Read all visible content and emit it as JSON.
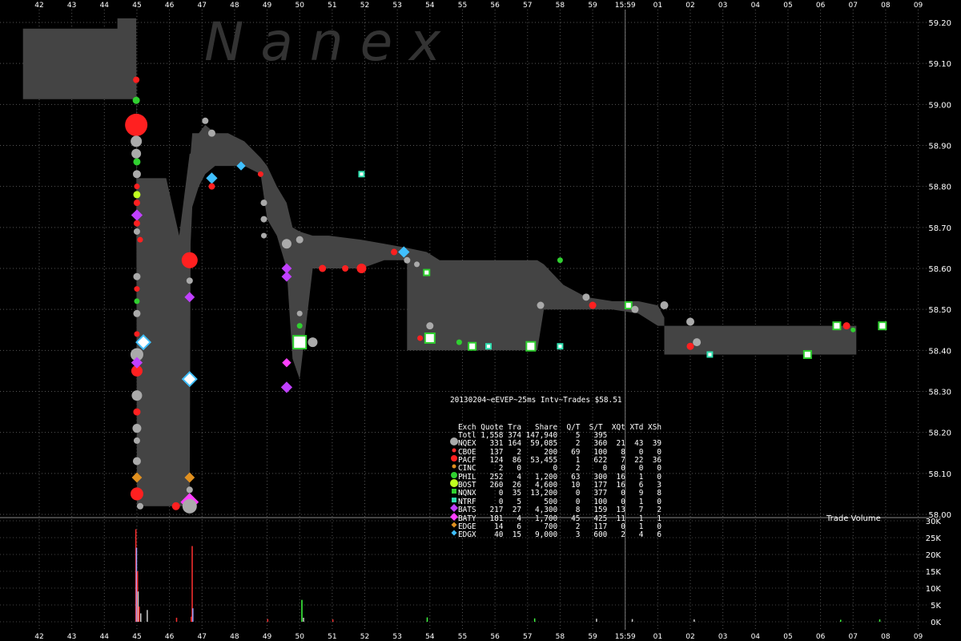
{
  "chart_data": {
    "type": "scatter",
    "watermark": "Nanex",
    "title": "20130204~eEVEP~25ms Intv~Trades $58.51",
    "x_ticks_top": [
      "42",
      "43",
      "44",
      "45",
      "46",
      "47",
      "48",
      "49",
      "50",
      "51",
      "52",
      "53",
      "54",
      "55",
      "56",
      "57",
      "58",
      "59",
      "15:59",
      "01",
      "02",
      "03",
      "04",
      "05",
      "06",
      "07",
      "08",
      "09"
    ],
    "x_ticks_bottom": [
      "42",
      "43",
      "44",
      "45",
      "46",
      "47",
      "48",
      "49",
      "50",
      "51",
      "52",
      "53",
      "54",
      "55",
      "56",
      "57",
      "58",
      "59",
      "15:59",
      "01",
      "02",
      "03",
      "04",
      "05",
      "06",
      "07",
      "08",
      "09"
    ],
    "price_axis": {
      "ticks": [
        "59.20",
        "59.10",
        "59.00",
        "58.90",
        "58.80",
        "58.70",
        "58.60",
        "58.50",
        "58.40",
        "58.30",
        "58.20",
        "58.10",
        "58.00"
      ],
      "ylim": [
        58.0,
        59.2
      ]
    },
    "volume_axis": {
      "label": "Trade Volume",
      "ticks": [
        "30K",
        "25K",
        "20K",
        "15K",
        "10K",
        "5K",
        "0K"
      ],
      "ylim": [
        0,
        30000
      ]
    },
    "nbbo_spread": [
      [
        41.5,
        59.013,
        59.185
      ],
      [
        44.4,
        59.013,
        59.185
      ],
      [
        44.4,
        59.013,
        59.21
      ],
      [
        44.98,
        59.013,
        59.21
      ],
      [
        45.0,
        58.02,
        58.82
      ],
      [
        45.05,
        58.02,
        58.82
      ],
      [
        45.06,
        58.02,
        58.82
      ],
      [
        45.9,
        58.02,
        58.82
      ],
      [
        46.3,
        58.02,
        58.68
      ],
      [
        46.62,
        58.02,
        58.88
      ],
      [
        46.65,
        58.66,
        58.88
      ],
      [
        46.7,
        58.75,
        58.93
      ],
      [
        46.9,
        58.8,
        58.93
      ],
      [
        47.1,
        58.83,
        58.95
      ],
      [
        47.4,
        58.85,
        58.93
      ],
      [
        47.8,
        58.85,
        58.93
      ],
      [
        48.3,
        58.85,
        58.91
      ],
      [
        48.8,
        58.83,
        58.87
      ],
      [
        49.0,
        58.72,
        58.85
      ],
      [
        49.3,
        58.68,
        58.8
      ],
      [
        49.6,
        58.6,
        58.76
      ],
      [
        49.78,
        58.38,
        58.7
      ],
      [
        50.0,
        58.33,
        58.69
      ],
      [
        50.4,
        58.6,
        58.68
      ],
      [
        50.9,
        58.6,
        58.68
      ],
      [
        51.9,
        58.6,
        58.67
      ],
      [
        52.6,
        58.62,
        58.66
      ],
      [
        53.3,
        58.62,
        58.65
      ],
      [
        53.3,
        58.4,
        58.65
      ],
      [
        53.9,
        58.4,
        58.64
      ],
      [
        54.3,
        58.4,
        58.62
      ],
      [
        54.5,
        58.4,
        58.62
      ],
      [
        57.3,
        58.4,
        58.62
      ],
      [
        57.5,
        58.5,
        58.61
      ],
      [
        58.1,
        58.5,
        58.56
      ],
      [
        58.8,
        58.5,
        58.53
      ],
      [
        59.6,
        58.5,
        58.52
      ],
      [
        60.4,
        58.49,
        58.52
      ],
      [
        61.0,
        58.46,
        58.51
      ],
      [
        61.2,
        58.46,
        58.48
      ],
      [
        61.2,
        58.39,
        58.46
      ],
      [
        67.1,
        58.39,
        58.46
      ],
      [
        67.1,
        58.4,
        58.48
      ]
    ],
    "trades": [
      {
        "x": 44.98,
        "y": 59.06,
        "ex": "PACF",
        "s": 8
      },
      {
        "x": 44.98,
        "y": 59.01,
        "ex": "PHIL",
        "s": 9
      },
      {
        "x": 44.98,
        "y": 58.95,
        "ex": "PACF",
        "s": 28
      },
      {
        "x": 44.98,
        "y": 58.91,
        "ex": "NQEX",
        "s": 14
      },
      {
        "x": 44.98,
        "y": 58.88,
        "ex": "NQEX",
        "s": 12
      },
      {
        "x": 45.0,
        "y": 58.86,
        "ex": "PHIL",
        "s": 9
      },
      {
        "x": 45.0,
        "y": 58.83,
        "ex": "NQEX",
        "s": 10
      },
      {
        "x": 45.0,
        "y": 58.8,
        "ex": "PACF",
        "s": 7
      },
      {
        "x": 45.0,
        "y": 58.78,
        "ex": "BOST",
        "s": 9
      },
      {
        "x": 45.0,
        "y": 58.76,
        "ex": "PACF",
        "s": 8
      },
      {
        "x": 45.0,
        "y": 58.73,
        "ex": "BATS",
        "s": 8
      },
      {
        "x": 45.0,
        "y": 58.71,
        "ex": "PACF",
        "s": 8
      },
      {
        "x": 45.0,
        "y": 58.69,
        "ex": "NQEX",
        "s": 8
      },
      {
        "x": 45.1,
        "y": 58.67,
        "ex": "PACF",
        "s": 7
      },
      {
        "x": 45.0,
        "y": 58.58,
        "ex": "NQEX",
        "s": 9
      },
      {
        "x": 45.0,
        "y": 58.55,
        "ex": "PACF",
        "s": 7
      },
      {
        "x": 45.0,
        "y": 58.52,
        "ex": "PHIL",
        "s": 7
      },
      {
        "x": 45.0,
        "y": 58.49,
        "ex": "NQEX",
        "s": 9
      },
      {
        "x": 45.0,
        "y": 58.44,
        "ex": "PACF",
        "s": 7
      },
      {
        "x": 45.0,
        "y": 58.39,
        "ex": "NQEX",
        "s": 16
      },
      {
        "x": 45.0,
        "y": 58.35,
        "ex": "PACF",
        "s": 14
      },
      {
        "x": 45.0,
        "y": 58.37,
        "ex": "BATS",
        "s": 8
      },
      {
        "x": 45.0,
        "y": 58.29,
        "ex": "NQEX",
        "s": 13
      },
      {
        "x": 45.0,
        "y": 58.25,
        "ex": "PACF",
        "s": 9
      },
      {
        "x": 45.0,
        "y": 58.21,
        "ex": "NQEX",
        "s": 11
      },
      {
        "x": 45.0,
        "y": 58.18,
        "ex": "NQEX",
        "s": 8
      },
      {
        "x": 45.0,
        "y": 58.13,
        "ex": "NQEX",
        "s": 10
      },
      {
        "x": 45.0,
        "y": 58.09,
        "ex": "EDGE",
        "s": 7
      },
      {
        "x": 45.0,
        "y": 58.05,
        "ex": "PACF",
        "s": 16
      },
      {
        "x": 45.1,
        "y": 58.02,
        "ex": "NQEX",
        "s": 8
      },
      {
        "x": 45.2,
        "y": 58.42,
        "ex": "EDGX",
        "s": 12
      },
      {
        "x": 46.2,
        "y": 58.02,
        "ex": "PACF",
        "s": 10
      },
      {
        "x": 46.62,
        "y": 58.62,
        "ex": "PACF",
        "s": 20
      },
      {
        "x": 46.62,
        "y": 58.57,
        "ex": "NQEX",
        "s": 8
      },
      {
        "x": 46.62,
        "y": 58.53,
        "ex": "BATS",
        "s": 7
      },
      {
        "x": 46.62,
        "y": 58.33,
        "ex": "EDGX",
        "s": 12
      },
      {
        "x": 46.62,
        "y": 58.09,
        "ex": "EDGE",
        "s": 7
      },
      {
        "x": 46.62,
        "y": 58.06,
        "ex": "NQEX",
        "s": 8
      },
      {
        "x": 46.62,
        "y": 58.03,
        "ex": "BATY",
        "s": 14
      },
      {
        "x": 46.62,
        "y": 58.02,
        "ex": "NQEX",
        "s": 18
      },
      {
        "x": 47.1,
        "y": 58.96,
        "ex": "NQEX",
        "s": 8
      },
      {
        "x": 47.3,
        "y": 58.93,
        "ex": "NQEX",
        "s": 9
      },
      {
        "x": 47.3,
        "y": 58.82,
        "ex": "EDGX",
        "s": 8
      },
      {
        "x": 47.3,
        "y": 58.8,
        "ex": "PACF",
        "s": 8
      },
      {
        "x": 48.2,
        "y": 58.85,
        "ex": "EDGX",
        "s": 6
      },
      {
        "x": 48.8,
        "y": 58.83,
        "ex": "PACF",
        "s": 7
      },
      {
        "x": 48.9,
        "y": 58.76,
        "ex": "NQEX",
        "s": 8
      },
      {
        "x": 48.9,
        "y": 58.72,
        "ex": "NQEX",
        "s": 8
      },
      {
        "x": 48.9,
        "y": 58.68,
        "ex": "NQEX",
        "s": 7
      },
      {
        "x": 49.6,
        "y": 58.66,
        "ex": "NQEX",
        "s": 12
      },
      {
        "x": 50.0,
        "y": 58.67,
        "ex": "NQEX",
        "s": 9
      },
      {
        "x": 49.6,
        "y": 58.6,
        "ex": "BATS",
        "s": 7
      },
      {
        "x": 49.6,
        "y": 58.58,
        "ex": "BATS",
        "s": 7
      },
      {
        "x": 49.6,
        "y": 58.37,
        "ex": "BATY",
        "s": 6
      },
      {
        "x": 49.6,
        "y": 58.31,
        "ex": "BATS",
        "s": 8
      },
      {
        "x": 50.0,
        "y": 58.49,
        "ex": "NQEX",
        "s": 7
      },
      {
        "x": 50.0,
        "y": 58.46,
        "ex": "PHIL",
        "s": 7
      },
      {
        "x": 50.0,
        "y": 58.42,
        "ex": "NQVX",
        "s": 16
      },
      {
        "x": 50.4,
        "y": 58.42,
        "ex": "NQEX",
        "s": 12
      },
      {
        "x": 50.7,
        "y": 58.6,
        "ex": "PACF",
        "s": 9
      },
      {
        "x": 51.4,
        "y": 58.6,
        "ex": "PACF",
        "s": 8
      },
      {
        "x": 51.9,
        "y": 58.6,
        "ex": "PACF",
        "s": 12
      },
      {
        "x": 51.9,
        "y": 58.83,
        "ex": "NTRF",
        "s": 6
      },
      {
        "x": 52.9,
        "y": 58.64,
        "ex": "PACF",
        "s": 8
      },
      {
        "x": 53.2,
        "y": 58.64,
        "ex": "EDGX",
        "s": 8
      },
      {
        "x": 53.3,
        "y": 58.62,
        "ex": "NQEX",
        "s": 8
      },
      {
        "x": 53.6,
        "y": 58.61,
        "ex": "NQEX",
        "s": 7
      },
      {
        "x": 53.9,
        "y": 58.59,
        "ex": "NQVX",
        "s": 7
      },
      {
        "x": 53.7,
        "y": 58.43,
        "ex": "PACF",
        "s": 7
      },
      {
        "x": 54.0,
        "y": 58.46,
        "ex": "NQEX",
        "s": 9
      },
      {
        "x": 54.0,
        "y": 58.43,
        "ex": "NQVX",
        "s": 12
      },
      {
        "x": 54.9,
        "y": 58.42,
        "ex": "PHIL",
        "s": 7
      },
      {
        "x": 55.3,
        "y": 58.41,
        "ex": "NQVX",
        "s": 9
      },
      {
        "x": 55.8,
        "y": 58.41,
        "ex": "NTRF",
        "s": 6
      },
      {
        "x": 57.1,
        "y": 58.41,
        "ex": "NQVX",
        "s": 11
      },
      {
        "x": 58.0,
        "y": 58.41,
        "ex": "NTRF",
        "s": 6
      },
      {
        "x": 58.0,
        "y": 58.62,
        "ex": "PHIL",
        "s": 7
      },
      {
        "x": 57.4,
        "y": 58.51,
        "ex": "NQEX",
        "s": 9
      },
      {
        "x": 58.8,
        "y": 58.53,
        "ex": "NQEX",
        "s": 9
      },
      {
        "x": 59.0,
        "y": 58.51,
        "ex": "PACF",
        "s": 9
      },
      {
        "x": 60.1,
        "y": 58.51,
        "ex": "NQVX",
        "s": 8
      },
      {
        "x": 60.3,
        "y": 58.5,
        "ex": "NQEX",
        "s": 9
      },
      {
        "x": 61.2,
        "y": 58.51,
        "ex": "NQEX",
        "s": 10
      },
      {
        "x": 62.0,
        "y": 58.47,
        "ex": "NQEX",
        "s": 10
      },
      {
        "x": 62.0,
        "y": 58.41,
        "ex": "PACF",
        "s": 9
      },
      {
        "x": 62.2,
        "y": 58.42,
        "ex": "NQEX",
        "s": 10
      },
      {
        "x": 62.6,
        "y": 58.39,
        "ex": "NTRF",
        "s": 6
      },
      {
        "x": 65.6,
        "y": 58.39,
        "ex": "NQVX",
        "s": 9
      },
      {
        "x": 66.5,
        "y": 58.46,
        "ex": "NQVX",
        "s": 9
      },
      {
        "x": 66.8,
        "y": 58.46,
        "ex": "PACF",
        "s": 9
      },
      {
        "x": 67.0,
        "y": 58.45,
        "ex": "PHIL",
        "s": 6
      },
      {
        "x": 67.9,
        "y": 58.46,
        "ex": "NQVX",
        "s": 9
      }
    ],
    "volume_bars": [
      {
        "x": 44.95,
        "v": 27500,
        "c": "#ff3030"
      },
      {
        "x": 44.97,
        "v": 22000,
        "c": "#9aa0ff"
      },
      {
        "x": 45.0,
        "v": 15000,
        "c": "#ff3030"
      },
      {
        "x": 45.02,
        "v": 9000,
        "c": "#cccccc"
      },
      {
        "x": 45.05,
        "v": 4500,
        "c": "#ff3030"
      },
      {
        "x": 45.1,
        "v": 2500,
        "c": "#cccccc"
      },
      {
        "x": 45.3,
        "v": 3500,
        "c": "#cccccc"
      },
      {
        "x": 46.2,
        "v": 1200,
        "c": "#ff3030"
      },
      {
        "x": 46.65,
        "v": 1500,
        "c": "#ff3030"
      },
      {
        "x": 46.68,
        "v": 22500,
        "c": "#ff3030"
      },
      {
        "x": 46.7,
        "v": 4000,
        "c": "#9aa0ff"
      },
      {
        "x": 50.05,
        "v": 6500,
        "c": "#40ff40"
      },
      {
        "x": 50.1,
        "v": 1200,
        "c": "#cccccc"
      },
      {
        "x": 49.0,
        "v": 800,
        "c": "#ff3030"
      },
      {
        "x": 51.0,
        "v": 700,
        "c": "#ff3030"
      },
      {
        "x": 53.9,
        "v": 1300,
        "c": "#40ff40"
      },
      {
        "x": 57.2,
        "v": 1000,
        "c": "#40ff40"
      },
      {
        "x": 59.1,
        "v": 900,
        "c": "#cccccc"
      },
      {
        "x": 60.2,
        "v": 800,
        "c": "#cccccc"
      },
      {
        "x": 62.1,
        "v": 700,
        "c": "#cccccc"
      },
      {
        "x": 66.6,
        "v": 600,
        "c": "#40ff40"
      },
      {
        "x": 67.8,
        "v": 700,
        "c": "#40ff40"
      }
    ],
    "legend_rows": [
      {
        "text": "Exch Quote Tra   Share  Q/T  S/T  XQt XTd XSh",
        "sym": "",
        "color": ""
      },
      {
        "text": "Totl 1,558 374 147,940    5   395",
        "sym": "",
        "color": ""
      },
      {
        "text": "NQEX   331 164  59,085    2   360  21  43  39",
        "sym": "circle-lg",
        "color": "#aaaaaa"
      },
      {
        "text": "CBOE   137   2     200   69   100   8   0   0",
        "sym": "dot",
        "color": "#ff3030"
      },
      {
        "text": "PACF   124  86  53,455    1   622   7  22  36",
        "sym": "circle",
        "color": "#ff2020"
      },
      {
        "text": "CINC     2   0       0    2     0   0   0   0",
        "sym": "dot",
        "color": "#e09020"
      },
      {
        "text": "PHIL   252   4   1,200   63   300  16   1   0",
        "sym": "circle",
        "color": "#30d030"
      },
      {
        "text": "BOST   260  26   4,600   10   177  16   6   3",
        "sym": "circle-lg",
        "color": "#c0ff20"
      },
      {
        "text": "NQNX     0  35  13,200    0   377   0   9   8",
        "sym": "square",
        "color": "#30d030"
      },
      {
        "text": "NTRF     0   5     500    0   100   0   1   0",
        "sym": "square",
        "color": "#30e0b0"
      },
      {
        "text": "BATS   217  27   4,300    8   159  13   7   2",
        "sym": "diamond",
        "color": "#c040ff"
      },
      {
        "text": "BATY   181   4   1,700   45   425  11   1   1",
        "sym": "diamond",
        "color": "#ff40ff"
      },
      {
        "text": "EDGE    14   6     700    2   117   0   1   0",
        "sym": "diamond-sm",
        "color": "#e09020"
      },
      {
        "text": "EDGX    40  15   9,000    3   600   2   4   6",
        "sym": "diamond-sm",
        "color": "#40c0ff"
      }
    ],
    "exchange_colors": {
      "NQEX": "#aaaaaa",
      "PACF": "#ff2020",
      "PHIL": "#30d030",
      "BOST": "#c0ff20",
      "BATS": "#c040ff",
      "BATY": "#ff40ff",
      "EDGE": "#e09020",
      "EDGX": "#40c0ff",
      "NQVX": "#30d030",
      "NTRF": "#30e0b0"
    },
    "colors": {
      "background": "#000000",
      "spread": "#444444",
      "grid": "#666666",
      "axis_text": "#ffffff"
    }
  }
}
